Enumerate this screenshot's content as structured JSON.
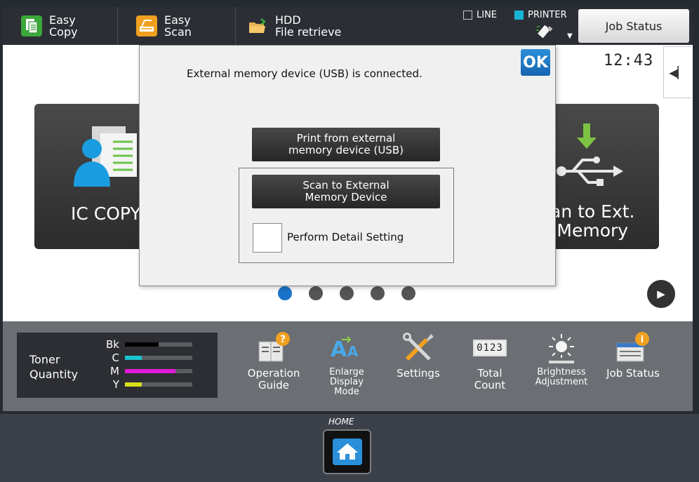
{
  "top_bar": {
    "easy_copy": {
      "line1": "Easy",
      "line2": "Copy"
    },
    "easy_scan": {
      "line1": "Easy",
      "line2": "Scan"
    },
    "hdd": {
      "line1": "HDD",
      "line2": "File retrieve"
    },
    "indicator_line": "LINE",
    "indicator_printer": "PRINTER",
    "job_status": "Job Status"
  },
  "home": {
    "clock": "12:43",
    "tile_left_label": "IC COPY",
    "tile_right_line1": "an to Ext.",
    "tile_right_line2": "Memory",
    "page_count": 5,
    "active_page": 1
  },
  "dialog": {
    "message": "External memory device (USB) is connected.",
    "ok": "OK",
    "print_btn_line1": "Print from external",
    "print_btn_line2": "memory device (USB)",
    "scan_btn_line1": "Scan to External",
    "scan_btn_line2": "Memory Device",
    "detail_label": "Perform Detail Setting",
    "detail_checked": false
  },
  "toner": {
    "title_line1": "Toner",
    "title_line2": "Quantity",
    "items": [
      {
        "name": "Bk",
        "level": 0.5,
        "color": "#000000"
      },
      {
        "name": "C",
        "level": 0.25,
        "color": "#19c3cf"
      },
      {
        "name": "M",
        "level": 0.75,
        "color": "#e21ad8"
      },
      {
        "name": "Y",
        "level": 0.25,
        "color": "#d8e01a"
      }
    ]
  },
  "functions": {
    "operation_guide": {
      "line1": "Operation",
      "line2": "Guide"
    },
    "enlarge_display": {
      "line1": "Enlarge",
      "line2": "Display",
      "line3": "Mode"
    },
    "settings": "Settings",
    "total_count": {
      "line1": "Total",
      "line2": "Count",
      "counter": "0123"
    },
    "brightness": {
      "line1": "Brightness",
      "line2": "Adjustment"
    },
    "job_status": "Job Status"
  },
  "home_label": "HOME"
}
